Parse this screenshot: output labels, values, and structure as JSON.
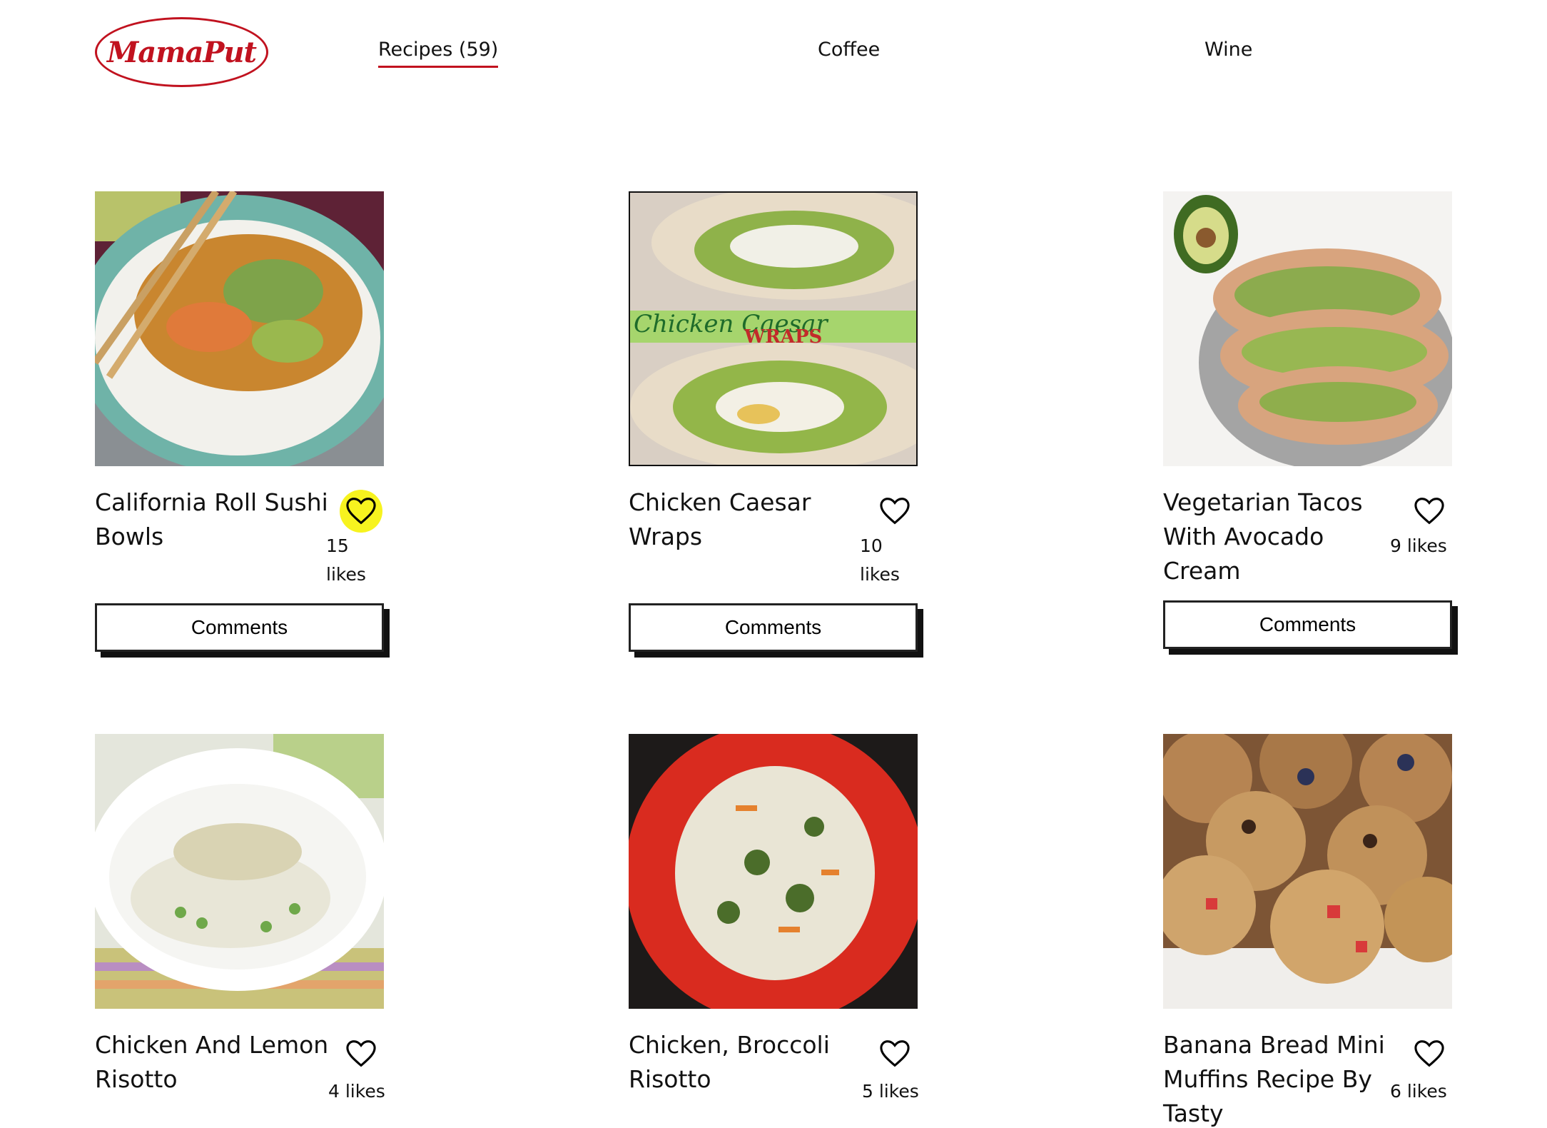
{
  "header": {
    "logo_text": "MamaPut",
    "nav": [
      {
        "label": "Recipes (59)",
        "active": true
      },
      {
        "label": "Coffee",
        "active": false
      },
      {
        "label": "Wine",
        "active": false
      }
    ]
  },
  "colors": {
    "brand": "#c1121f",
    "like_highlight": "#f7f31f"
  },
  "recipes": [
    {
      "title": "California Roll Sushi Bowls",
      "likes_num": "15",
      "likes_word": "likes",
      "liked": true,
      "comments_label": "Comments",
      "image_icon": "sushi-bowl-image"
    },
    {
      "title": "Chicken Caesar Wraps",
      "likes_num": "10",
      "likes_word": "likes",
      "liked": false,
      "comments_label": "Comments",
      "image_icon": "caesar-wrap-image",
      "image_text_1": "Chicken Caesar",
      "image_text_2": "WRAPS"
    },
    {
      "title": "Vegetarian Tacos With Avocado Cream",
      "likes": "9 likes",
      "liked": false,
      "comments_label": "Comments",
      "image_icon": "veggie-tacos-image"
    },
    {
      "title": "Chicken And Lemon Risotto",
      "likes": "4 likes",
      "liked": false,
      "image_icon": "lemon-risotto-image"
    },
    {
      "title": "Chicken, Broccoli Risotto",
      "likes": "5 likes",
      "liked": false,
      "image_icon": "broccoli-risotto-image"
    },
    {
      "title": "Banana Bread Mini Muffins Recipe By Tasty",
      "likes": "6 likes",
      "liked": false,
      "image_icon": "muffins-image"
    }
  ]
}
